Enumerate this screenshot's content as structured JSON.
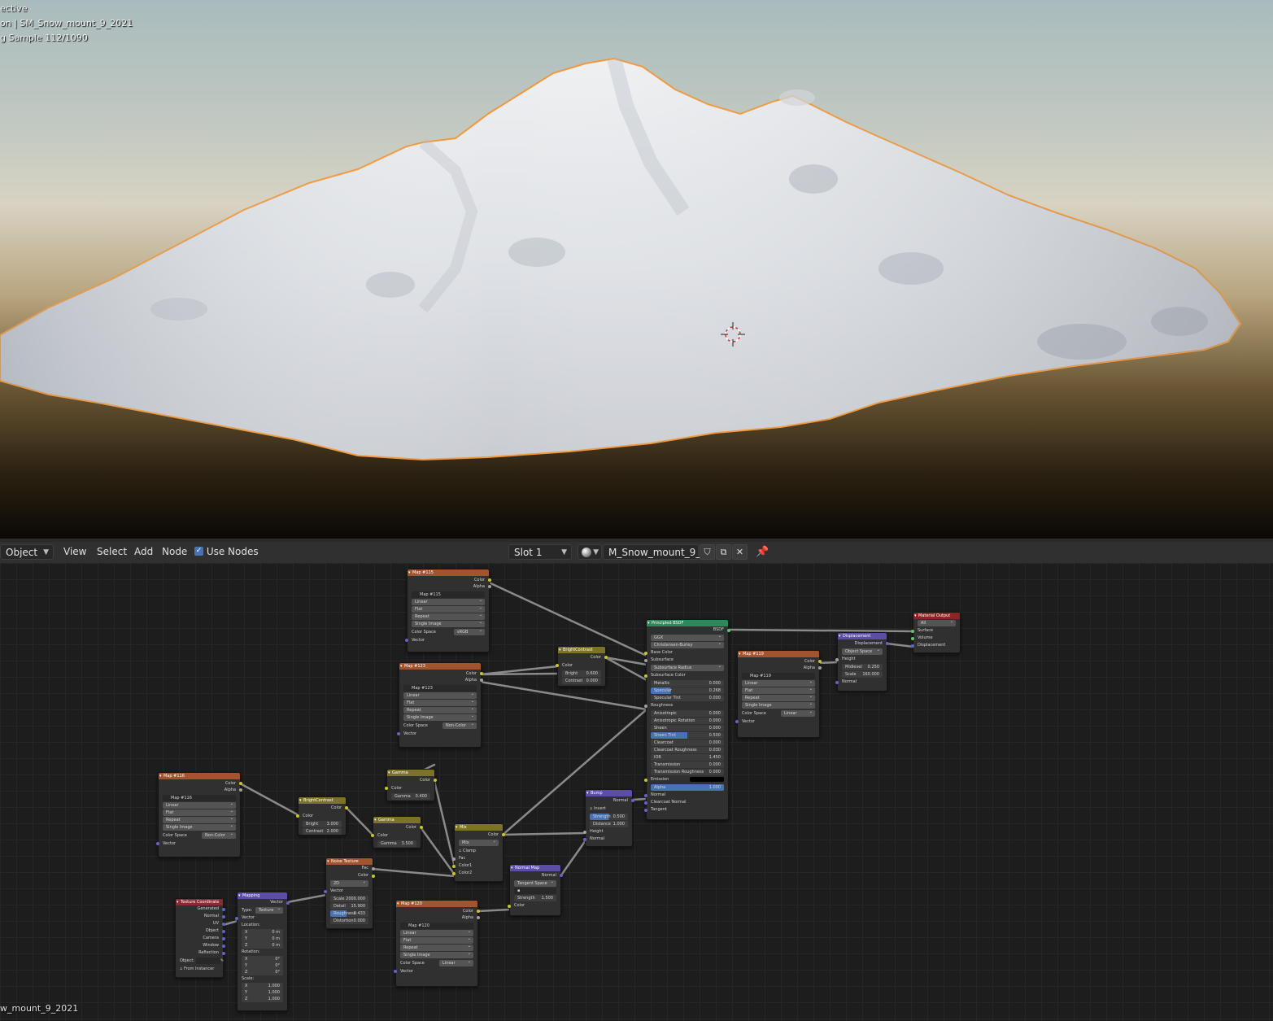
{
  "viewport": {
    "info_lines": [
      "ective",
      "on | SM_Snow_mount_9_2021",
      "g Sample 112/1090"
    ]
  },
  "header": {
    "editor_type": "Object",
    "menus": [
      "View",
      "Select",
      "Add",
      "Node"
    ],
    "use_nodes_label": "Use Nodes",
    "use_nodes_checked": true,
    "slot": "Slot 1",
    "material_name": "M_Snow_mount_9_..."
  },
  "nodes": {
    "tex_common": {
      "color": "Color",
      "alpha": "Alpha",
      "vector": "Vector",
      "linear": "Linear",
      "flat": "Flat",
      "repeat": "Repeat",
      "single_image": "Single Image",
      "color_space": "Color Space"
    },
    "map115": {
      "title": "Map #115",
      "image": "Map #115",
      "color_space": "sRGB"
    },
    "map123": {
      "title": "Map #123",
      "image": "Map #123",
      "color_space": "Non-Color"
    },
    "map116": {
      "title": "Map #116",
      "image": "Map #116",
      "color_space": "Non-Color"
    },
    "map119": {
      "title": "Map #119",
      "image": "Map #119",
      "color_space": "Linear"
    },
    "map120": {
      "title": "Map #120",
      "image": "Map #120",
      "color_space": "Linear"
    },
    "bc1": {
      "title": "BrightContrast",
      "color": "Color",
      "bright": "Bright",
      "bright_val": "0.600",
      "contrast": "Contrast",
      "contrast_val": "0.000"
    },
    "bc2": {
      "title": "BrightContrast",
      "color": "Color",
      "bright": "Bright",
      "bright_val": "3.000",
      "contrast": "Contrast",
      "contrast_val": "2.000"
    },
    "gamma1": {
      "title": "Gamma",
      "color": "Color",
      "gamma": "Gamma",
      "gamma_val": "0.400"
    },
    "gamma2": {
      "title": "Gamma",
      "color": "Color",
      "gamma": "Gamma",
      "gamma_val": "3.500"
    },
    "mix": {
      "title": "Mix",
      "color": "Color",
      "mode": "Mix",
      "clamp": "Clamp",
      "fac": "Fac",
      "color1": "Color1",
      "color2": "Color2"
    },
    "noise": {
      "title": "Noise Texture",
      "fac": "Fac",
      "color": "Color",
      "dim": "2D",
      "vector": "Vector",
      "scale": "Scale",
      "scale_val": "2000.000",
      "detail": "Detail",
      "detail_val": "15.900",
      "rough": "Roughness",
      "rough_val": "0.433",
      "dist": "Distortion",
      "dist_val": "0.000"
    },
    "texcoord": {
      "title": "Texture Coordinate",
      "outputs": [
        "Generated",
        "Normal",
        "UV",
        "Object",
        "Camera",
        "Window",
        "Reflection"
      ],
      "object": "Object:",
      "from_instancer": "From Instancer"
    },
    "mapping": {
      "title": "Mapping",
      "vector_out": "Vector",
      "type": "Type:",
      "type_val": "Texture",
      "vector": "Vector",
      "location": "Location:",
      "rotation": "Rotation:",
      "scale": "Scale:",
      "loc": [
        [
          "X",
          "0 m"
        ],
        [
          "Y",
          "0 m"
        ],
        [
          "Z",
          "0 m"
        ]
      ],
      "rot": [
        [
          "X",
          "0°"
        ],
        [
          "Y",
          "0°"
        ],
        [
          "Z",
          "0°"
        ]
      ],
      "scl": [
        [
          "X",
          "1.000"
        ],
        [
          "Y",
          "1.000"
        ],
        [
          "Z",
          "1.000"
        ]
      ]
    },
    "bump": {
      "title": "Bump",
      "normal": "Normal",
      "invert": "Invert",
      "strength": "Strength",
      "strength_val": "0.500",
      "distance": "Distance",
      "distance_val": "1.000",
      "height": "Height",
      "normal_in": "Normal"
    },
    "normalmap": {
      "title": "Normal Map",
      "normal": "Normal",
      "space": "Tangent Space",
      "strength": "Strength",
      "strength_val": "1.500",
      "color": "Color"
    },
    "bsdf": {
      "title": "Principled BSDF",
      "bsdf": "BSDF",
      "dist": "GGX",
      "sss": "Christensen-Burley",
      "base_color": "Base Color",
      "subsurface": "Subsurface",
      "sss_radius": "Subsurface Radius",
      "sss_color": "Subsurface Color",
      "params": [
        [
          "Metallic",
          "0.000",
          false
        ],
        [
          "Specular",
          "0.268",
          true
        ],
        [
          "Specular Tint",
          "0.000",
          false
        ]
      ],
      "roughness": "Roughness",
      "params2": [
        [
          "Anisotropic",
          "0.000",
          false
        ],
        [
          "Anisotropic Rotation",
          "0.000",
          false
        ],
        [
          "Sheen",
          "0.000",
          false
        ],
        [
          "Sheen Tint",
          "0.500",
          true
        ],
        [
          "Clearcoat",
          "0.000",
          false
        ],
        [
          "Clearcoat Roughness",
          "0.030",
          false
        ],
        [
          "IOR",
          "1.450",
          false
        ],
        [
          "Transmission",
          "0.000",
          false
        ],
        [
          "Transmission Roughness",
          "0.000",
          false
        ]
      ],
      "emission": "Emission",
      "alpha": "Alpha",
      "alpha_val": "1.000",
      "normal": "Normal",
      "cc_normal": "Clearcoat Normal",
      "tangent": "Tangent"
    },
    "disp": {
      "title": "Displacement",
      "displacement": "Displacement",
      "space": "Object Space",
      "height": "Height",
      "midlevel": "Midlevel",
      "midlevel_val": "0.250",
      "scale": "Scale",
      "scale_val": "160.000",
      "normal": "Normal"
    },
    "output": {
      "title": "Material Output",
      "target": "All",
      "surface": "Surface",
      "volume": "Volume",
      "displacement": "Displacement"
    }
  },
  "status": {
    "text": "w_mount_9_2021"
  }
}
